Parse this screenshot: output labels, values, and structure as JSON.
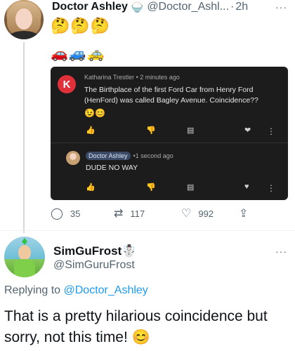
{
  "tweet1": {
    "name": "Doctor Ashley",
    "name_emoji": "🍚",
    "handle": "@Doctor_Ashl...",
    "dot": "·",
    "time": "2h",
    "more": "···",
    "emoji_line": "🤔🤔🤔",
    "cars_line": "🚗🚙🚕",
    "embedded": {
      "comment1": {
        "avatar_letter": "K",
        "author": "Katharina Trestler",
        "time": "2 minutes ago",
        "text": "The Birthplace of the first Ford Car from Henry Ford (HenFord) was called Bagley Avenue. Coincidence??",
        "emoji": "😉😊"
      },
      "comment2": {
        "author": "Doctor Ashley",
        "time": "1 second ago",
        "text": "DUDE NO WAY"
      },
      "icons": [
        "thumbs-up",
        "thumbs-down",
        "reply",
        "heart",
        "more-vertical"
      ]
    },
    "actions": {
      "replies": "35",
      "retweets": "117",
      "likes": "992"
    }
  },
  "tweet2": {
    "name": "SimGuFrost",
    "name_emoji": "☃️",
    "handle": "@SimGuruFrost",
    "more": "···",
    "replying_prefix": "Replying to",
    "replying_mention": "@Doctor_Ashley",
    "body": "That is a pretty hilarious coincidence but sorry, not this time! 😊"
  },
  "colors": {
    "link": "#1d9bf0",
    "secondary_text": "#536471",
    "dark_panel": "#1c1c1c",
    "comment_avatar": "#e0313a"
  }
}
